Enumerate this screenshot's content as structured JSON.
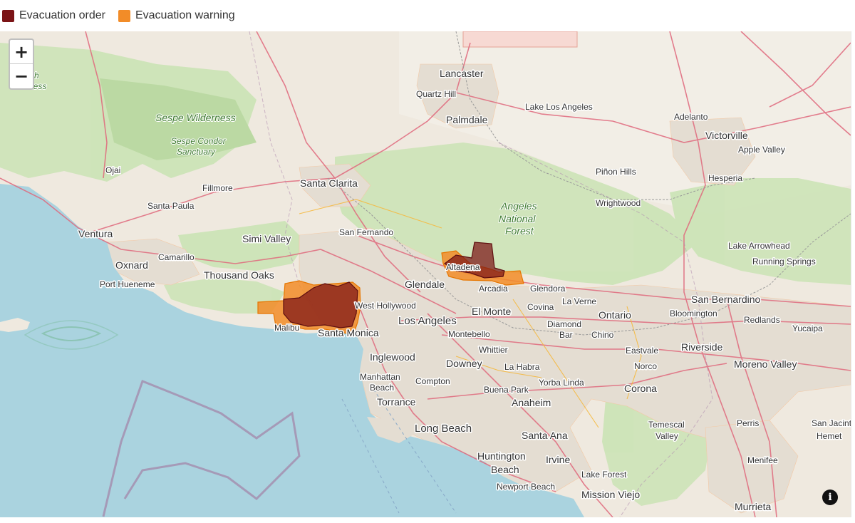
{
  "legend": {
    "items": [
      {
        "label": "Evacuation order",
        "color": "#7b1416"
      },
      {
        "label": "Evacuation warning",
        "color": "#f28c28"
      }
    ]
  },
  "controls": {
    "zoom_in": "+",
    "zoom_out": "−",
    "info": "i"
  },
  "colors": {
    "ocean": "#aad3df",
    "land": "#efe9df",
    "urban": "#e6e0d6",
    "forest": "#cde4b8",
    "evacuation_order": "#7b1416",
    "evacuation_warning": "#f28c28",
    "roads": "#e0697d",
    "highway": "#f5b93f"
  },
  "map": {
    "labels": {
      "lancaster": "Lancaster",
      "quartz_hill": "Quartz Hill",
      "palmdale": "Palmdale",
      "lake_los_angeles": "Lake Los Angeles",
      "adelanto": "Adelanto",
      "victorville": "Victorville",
      "apple_valley": "Apple Valley",
      "hesperia": "Hesperia",
      "pinon_hills": "Piñon Hills",
      "wrightwood": "Wrightwood",
      "sespe_wilderness": "Sespe Wilderness",
      "sespe_condor_1": "Sespe Condor",
      "sespe_condor_2": "Sanctuary",
      "smith_1": "Smith",
      "smith_2": "ness",
      "ojai": "Ojai",
      "fillmore": "Fillmore",
      "santa_clarita": "Santa Clarita",
      "santa_paula": "Santa Paula",
      "ventura": "Ventura",
      "simi_valley": "Simi Valley",
      "san_fernando": "San Fernando",
      "angeles_1": "Angeles",
      "angeles_2": "National",
      "angeles_3": "Forest",
      "lake_arrowhead": "Lake Arrowhead",
      "running_springs": "Running Springs",
      "oxnard": "Oxnard",
      "camarillo": "Camarillo",
      "thousand_oaks": "Thousand Oaks",
      "port_hueneme": "Port Hueneme",
      "altadena": "Altadena",
      "glendale": "Glendale",
      "arcadia": "Arcadia",
      "glendora": "Glendora",
      "san_bernardino": "San Bernardino",
      "west_hollywood": "West Hollywood",
      "la_verne": "La Verne",
      "covina": "Covina",
      "el_monte": "El Monte",
      "ontario": "Ontario",
      "bloomington": "Bloomington",
      "redlands": "Redlands",
      "malibu": "Malibu",
      "santa_monica": "Santa Monica",
      "los_angeles": "Los Angeles",
      "diamond_bar_1": "Diamond",
      "diamond_bar_2": "Bar",
      "chino": "Chino",
      "yucaipa": "Yucaipa",
      "montebello": "Montebello",
      "riverside": "Riverside",
      "inglewood": "Inglewood",
      "whittier": "Whittier",
      "eastvale": "Eastvale",
      "moreno_valley": "Moreno Valley",
      "manhattan_1": "Manhattan",
      "manhattan_2": "Beach",
      "downey": "Downey",
      "norco": "Norco",
      "la_habra": "La Habra",
      "compton": "Compton",
      "yorba_linda": "Yorba Linda",
      "buena_park": "Buena Park",
      "corona": "Corona",
      "torrance": "Torrance",
      "anaheim": "Anaheim",
      "temescal_1": "Temescal",
      "temescal_2": "Valley",
      "perris": "Perris",
      "san_jacinto": "San Jacint",
      "hemet": "Hemet",
      "long_beach": "Long Beach",
      "santa_ana": "Santa Ana",
      "huntington_1": "Huntington",
      "huntington_2": "Beach",
      "irvine": "Irvine",
      "menifee": "Menifee",
      "lake_forest": "Lake Forest",
      "newport_beach": "Newport Beach",
      "mission_viejo": "Mission Viejo",
      "murrieta": "Murrieta"
    }
  }
}
